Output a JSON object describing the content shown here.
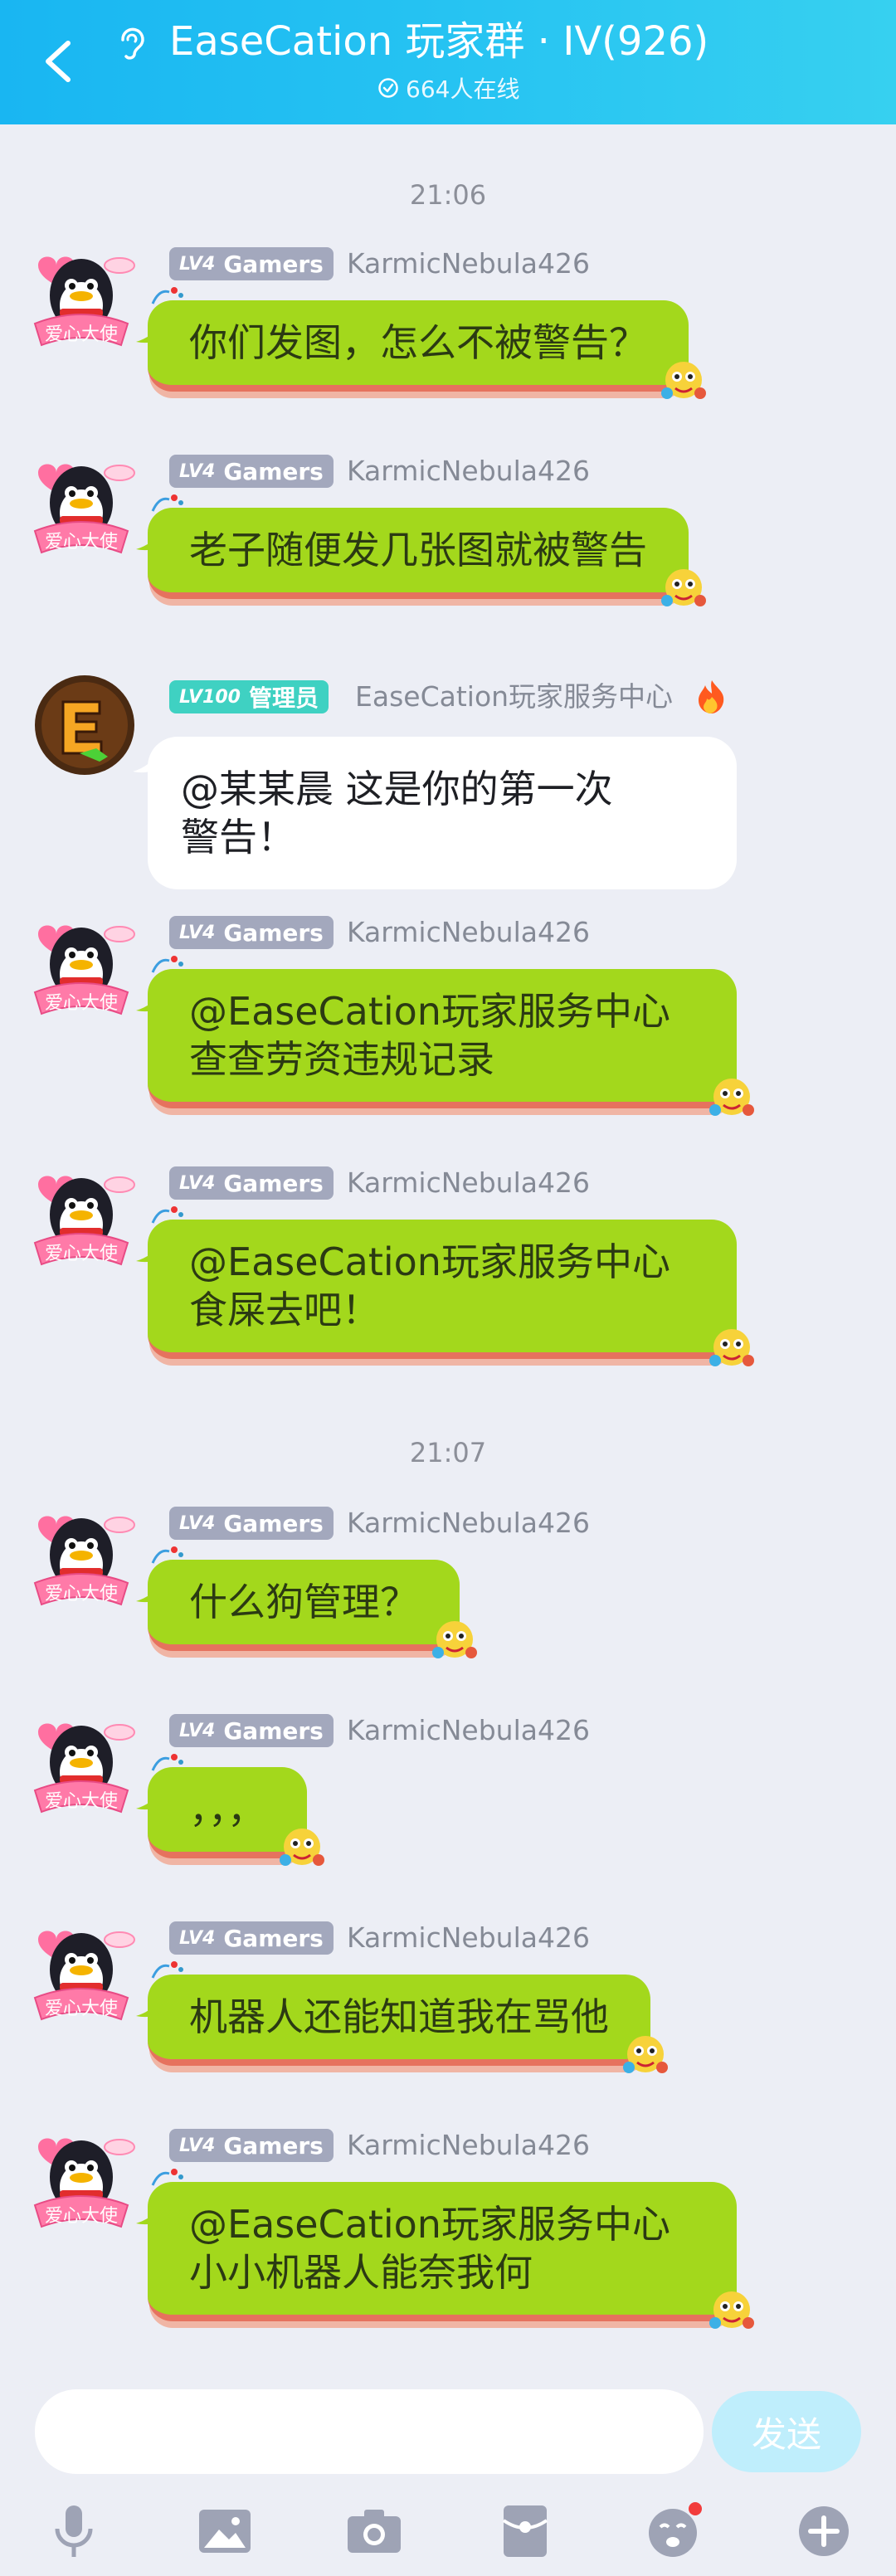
{
  "header": {
    "title": "EaseCation 玩家群 · IV(926)",
    "online": "664人在线",
    "bg_color": "#1fbdf2"
  },
  "timestamps": [
    "21:06",
    "21:07"
  ],
  "messages": [
    {
      "badge_lv": "LV4",
      "badge_text": "Gamers",
      "name": "KarmicNebula426",
      "text": [
        "你们发图，怎么不被警告？"
      ]
    },
    {
      "badge_lv": "LV4",
      "badge_text": "Gamers",
      "name": "KarmicNebula426",
      "text": [
        "老子随便发几张图就被警告"
      ]
    },
    {
      "badge_lv": "LV100",
      "badge_text": "管理员",
      "name": "EaseCation玩家服务中心",
      "text": [
        "@某某晨  这是你的第一次",
        "警告！"
      ]
    },
    {
      "badge_lv": "LV4",
      "badge_text": "Gamers",
      "name": "KarmicNebula426",
      "text": [
        "@EaseCation玩家服务中心",
        "查查劳资违规记录"
      ]
    },
    {
      "badge_lv": "LV4",
      "badge_text": "Gamers",
      "name": "KarmicNebula426",
      "text": [
        "@EaseCation玩家服务中心",
        "食屎去吧！"
      ]
    },
    {
      "badge_lv": "LV4",
      "badge_text": "Gamers",
      "name": "KarmicNebula426",
      "text": [
        "什么狗管理？"
      ]
    },
    {
      "badge_lv": "LV4",
      "badge_text": "Gamers",
      "name": "KarmicNebula426",
      "text": [
        "，，，"
      ]
    },
    {
      "badge_lv": "LV4",
      "badge_text": "Gamers",
      "name": "KarmicNebula426",
      "text": [
        "机器人还能知道我在骂他"
      ]
    },
    {
      "badge_lv": "LV4",
      "badge_text": "Gamers",
      "name": "KarmicNebula426",
      "text": [
        "@EaseCation玩家服务中心",
        "小小机器人能奈我何"
      ]
    }
  ],
  "input": {
    "placeholder": "",
    "send_label": "发送"
  },
  "toolbar": [
    "microphone-icon",
    "image-icon",
    "camera-icon",
    "red-packet-icon",
    "emoji-icon",
    "plus-icon"
  ],
  "colors": {
    "bubble_green": "#a3d81c",
    "bubble_white": "#ffffff",
    "accent": "#19b6f2",
    "notification": "#f23c3c"
  }
}
